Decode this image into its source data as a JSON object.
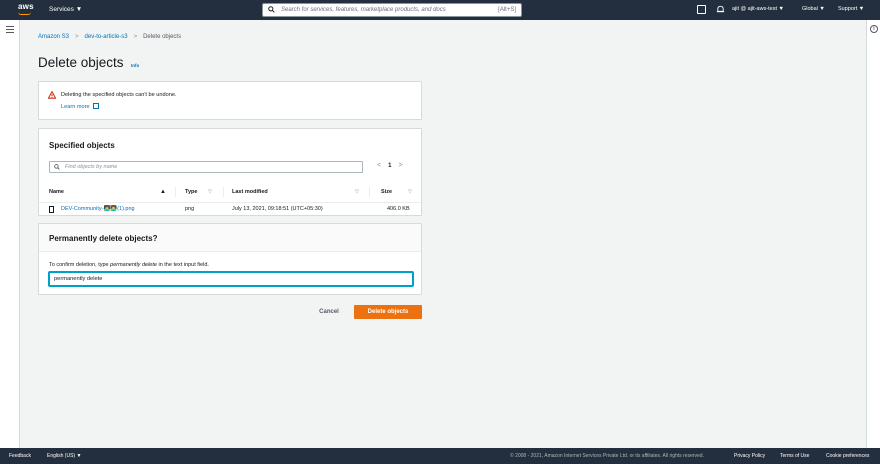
{
  "nav": {
    "logo": "aws",
    "services": "Services ▼",
    "search_placeholder": "Search for services, features, marketplace products, and docs",
    "search_shortcut": "[Alt+S]",
    "account": "ajit @ ajit-aws-test ▼",
    "region": "Global ▼",
    "support": "Support ▼"
  },
  "breadcrumb": {
    "item1": "Amazon S3",
    "item2": "dev-to-article-s3",
    "item3": "Delete objects",
    "sep": ">"
  },
  "page": {
    "title": "Delete objects",
    "info": "Info"
  },
  "alert": {
    "message": "Deleting the specified objects can't be undone.",
    "learn_more": "Learn more"
  },
  "specified": {
    "title": "Specified objects",
    "find_placeholder": "Find objects by name",
    "page_number": "1",
    "prev": "<",
    "next": ">",
    "columns": {
      "name": "Name",
      "type": "Type",
      "last_modified": "Last modified",
      "size": "Size"
    },
    "rows": [
      {
        "name": "DEV-Community-👩‍💻👨‍💻(1).png",
        "type": "png",
        "last_modified": "July 13, 2021, 09:18:51 (UTC+05:30)",
        "size": "406.0 KB"
      }
    ]
  },
  "permanent": {
    "title": "Permanently delete objects?",
    "hint_prefix": "To confirm deletion, type ",
    "hint_emph": "permanently delete",
    "hint_suffix": " in the text input field.",
    "input_value": "permanently delete"
  },
  "actions": {
    "cancel": "Cancel",
    "delete": "Delete objects"
  },
  "footer": {
    "feedback": "Feedback",
    "language": "English (US) ▼",
    "copyright": "© 2008 - 2021, Amazon Internet Services Private Ltd. or its affiliates. All rights reserved.",
    "privacy": "Privacy Policy",
    "terms": "Terms of Use",
    "cookies": "Cookie preferences"
  },
  "colors": {
    "nav_bg": "#232f3e",
    "link": "#0073bb",
    "primary_button": "#ec7211",
    "warning": "#d13212"
  },
  "icons": [
    "search-icon",
    "cloudshell-icon",
    "bell-icon",
    "menu-icon",
    "info-icon",
    "warning-icon",
    "external-link-icon",
    "file-icon",
    "sort-icon"
  ]
}
